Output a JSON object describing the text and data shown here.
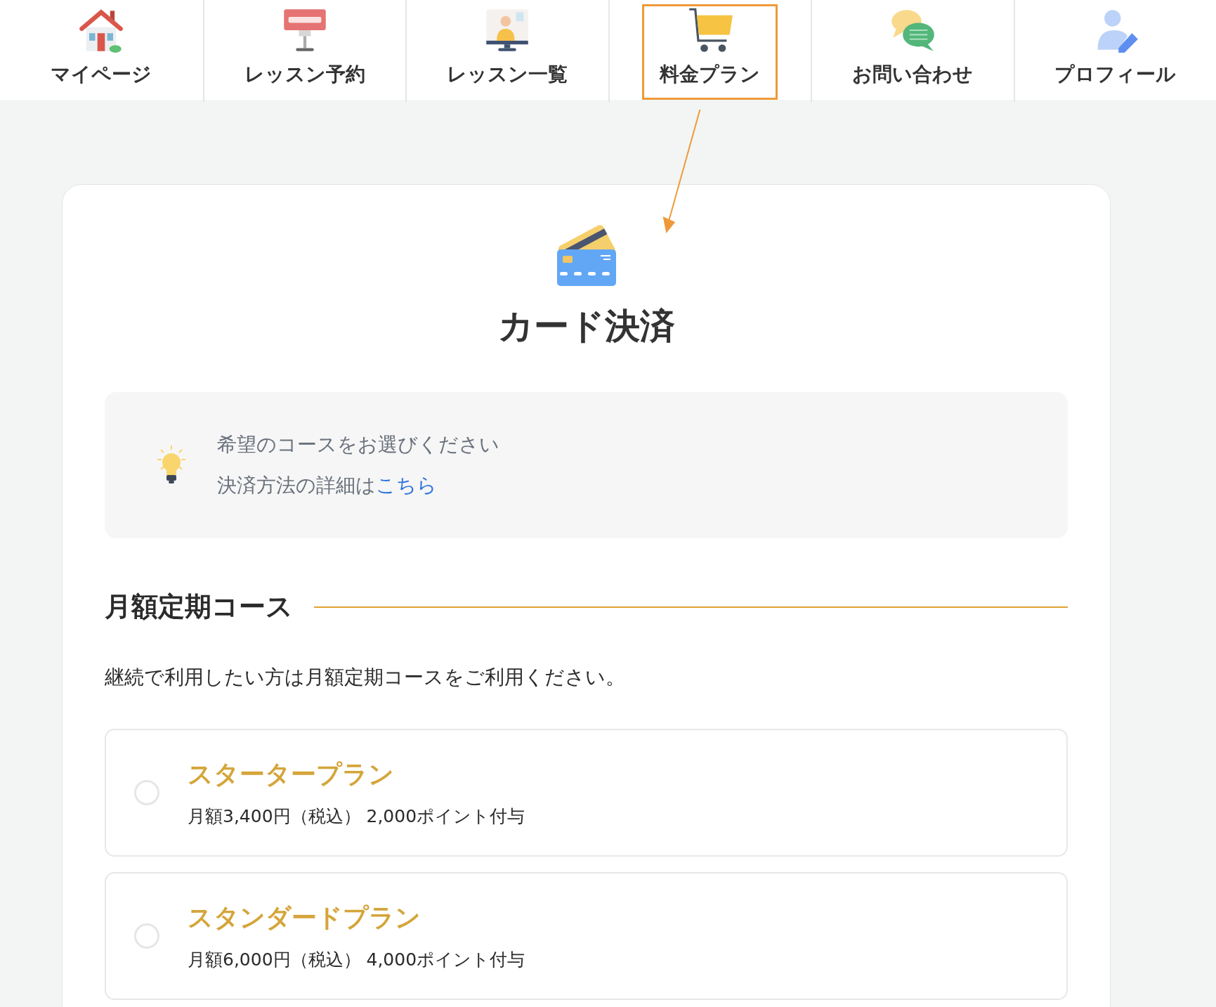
{
  "nav": {
    "tabs": [
      {
        "label": "マイページ",
        "highlighted": false
      },
      {
        "label": "レッスン予約",
        "highlighted": false
      },
      {
        "label": "レッスン一覧",
        "highlighted": false
      },
      {
        "label": "料金プラン",
        "highlighted": true
      },
      {
        "label": "お問い合わせ",
        "highlighted": false
      },
      {
        "label": "プロフィール",
        "highlighted": false
      }
    ]
  },
  "payment": {
    "title": "カード決済",
    "notice": {
      "line_1": "希望のコースをお選びください",
      "line_2": "決済方法の詳細は",
      "link": "こちら"
    },
    "section": {
      "heading": "月額定期コース",
      "description": "継続で利用したい方は月額定期コースをご利用ください。"
    },
    "plans": [
      {
        "name": "スタータープラン",
        "detail": "月額3,400円（税込） 2,000ポイント付与",
        "selected": false
      },
      {
        "name": "スタンダードプラン",
        "detail": "月額6,000円（税込） 4,000ポイント付与",
        "selected": false
      }
    ]
  }
}
